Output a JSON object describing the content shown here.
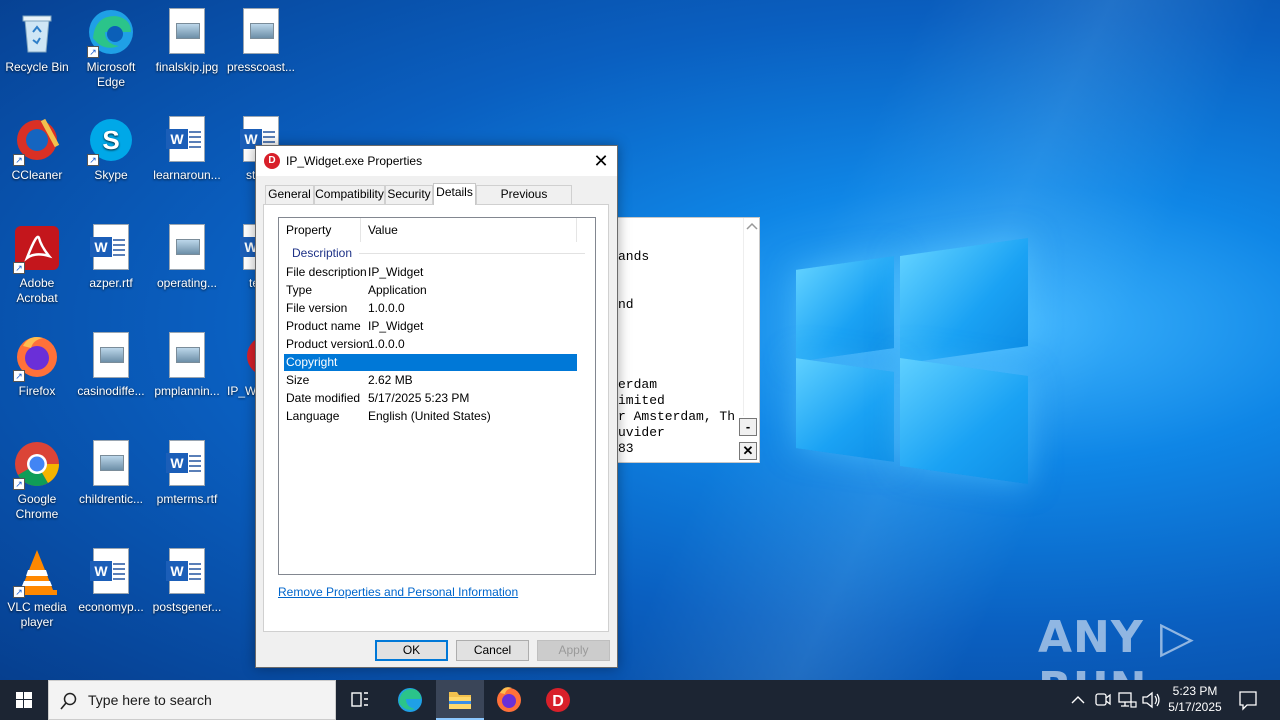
{
  "desktop": {
    "icons": [
      {
        "label": "Recycle Bin"
      },
      {
        "label": "Microsoft Edge"
      },
      {
        "label": "finalskip.jpg"
      },
      {
        "label": "presscoast..."
      },
      {
        "label": "CCleaner"
      },
      {
        "label": "Skype"
      },
      {
        "label": "learnaroun..."
      },
      {
        "label": "starte"
      },
      {
        "label": "Adobe Acrobat"
      },
      {
        "label": "azper.rtf"
      },
      {
        "label": "operating..."
      },
      {
        "label": "term"
      },
      {
        "label": "Firefox"
      },
      {
        "label": "casinodiffe..."
      },
      {
        "label": "pmplannin..."
      },
      {
        "label": "IP_W"
      },
      {
        "label": "Google Chrome"
      },
      {
        "label": "childrentic..."
      },
      {
        "label": "pmterms.rtf"
      },
      {
        "label": "VLC media player"
      },
      {
        "label": "economyp..."
      },
      {
        "label": "postsgener..."
      }
    ]
  },
  "console": {
    "lines": [
      "ands",
      "nd",
      "erdam",
      "imited",
      "r Amsterdam, Th",
      "uvider",
      "83"
    ],
    "minimize_glyph": "-",
    "close_glyph": "✕"
  },
  "dialog": {
    "title": "IP_Widget.exe Properties",
    "app_icon_letter": "D",
    "close_glyph": "✕",
    "tabs": [
      {
        "label": "General"
      },
      {
        "label": "Compatibility"
      },
      {
        "label": "Security"
      },
      {
        "label": "Details"
      },
      {
        "label": "Previous Versions"
      }
    ],
    "columns": {
      "property": "Property",
      "value": "Value"
    },
    "group": "Description",
    "rows": [
      {
        "key": "File description",
        "value": "IP_Widget"
      },
      {
        "key": "Type",
        "value": "Application"
      },
      {
        "key": "File version",
        "value": "1.0.0.0"
      },
      {
        "key": "Product name",
        "value": "IP_Widget"
      },
      {
        "key": "Product version",
        "value": "1.0.0.0"
      },
      {
        "key": "Copyright",
        "value": ""
      },
      {
        "key": "Size",
        "value": "2.62 MB"
      },
      {
        "key": "Date modified",
        "value": "5/17/2025 5:23 PM"
      },
      {
        "key": "Language",
        "value": "English (United States)"
      }
    ],
    "link": "Remove Properties and Personal Information",
    "buttons": {
      "ok": "OK",
      "cancel": "Cancel",
      "apply": "Apply"
    }
  },
  "watermark": "ANY ▷ RUN",
  "taskbar": {
    "search_placeholder": "Type here to search",
    "clock_time": "5:23 PM",
    "clock_date": "5/17/2025"
  },
  "colors": {
    "selection": "#0078d7",
    "taskbar": "#1c2533",
    "accent": "#0078d7"
  }
}
